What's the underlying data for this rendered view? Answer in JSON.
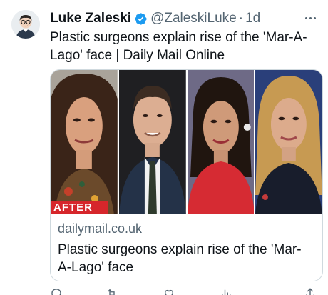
{
  "tweet": {
    "author_name": "Luke Zaleski",
    "handle": "@ZaleskiLuke",
    "separator": "·",
    "time": "1d",
    "text": "Plastic surgeons explain rise of the 'Mar-A-Lago' face | Daily Mail Online"
  },
  "card": {
    "domain": "dailymail.co.uk",
    "title": "Plastic surgeons explain rise of the 'Mar-A-Lago' face",
    "badge_text": "AFTER"
  },
  "icons": {
    "verified": "verified-badge-icon",
    "more": "more-options-icon",
    "reply": "reply-icon",
    "retweet": "retweet-icon",
    "like": "like-icon",
    "views": "views-icon",
    "share": "share-icon"
  },
  "colors": {
    "verified": "#1d9bf0",
    "secondary_text": "#536471",
    "badge": "#d6262b"
  }
}
